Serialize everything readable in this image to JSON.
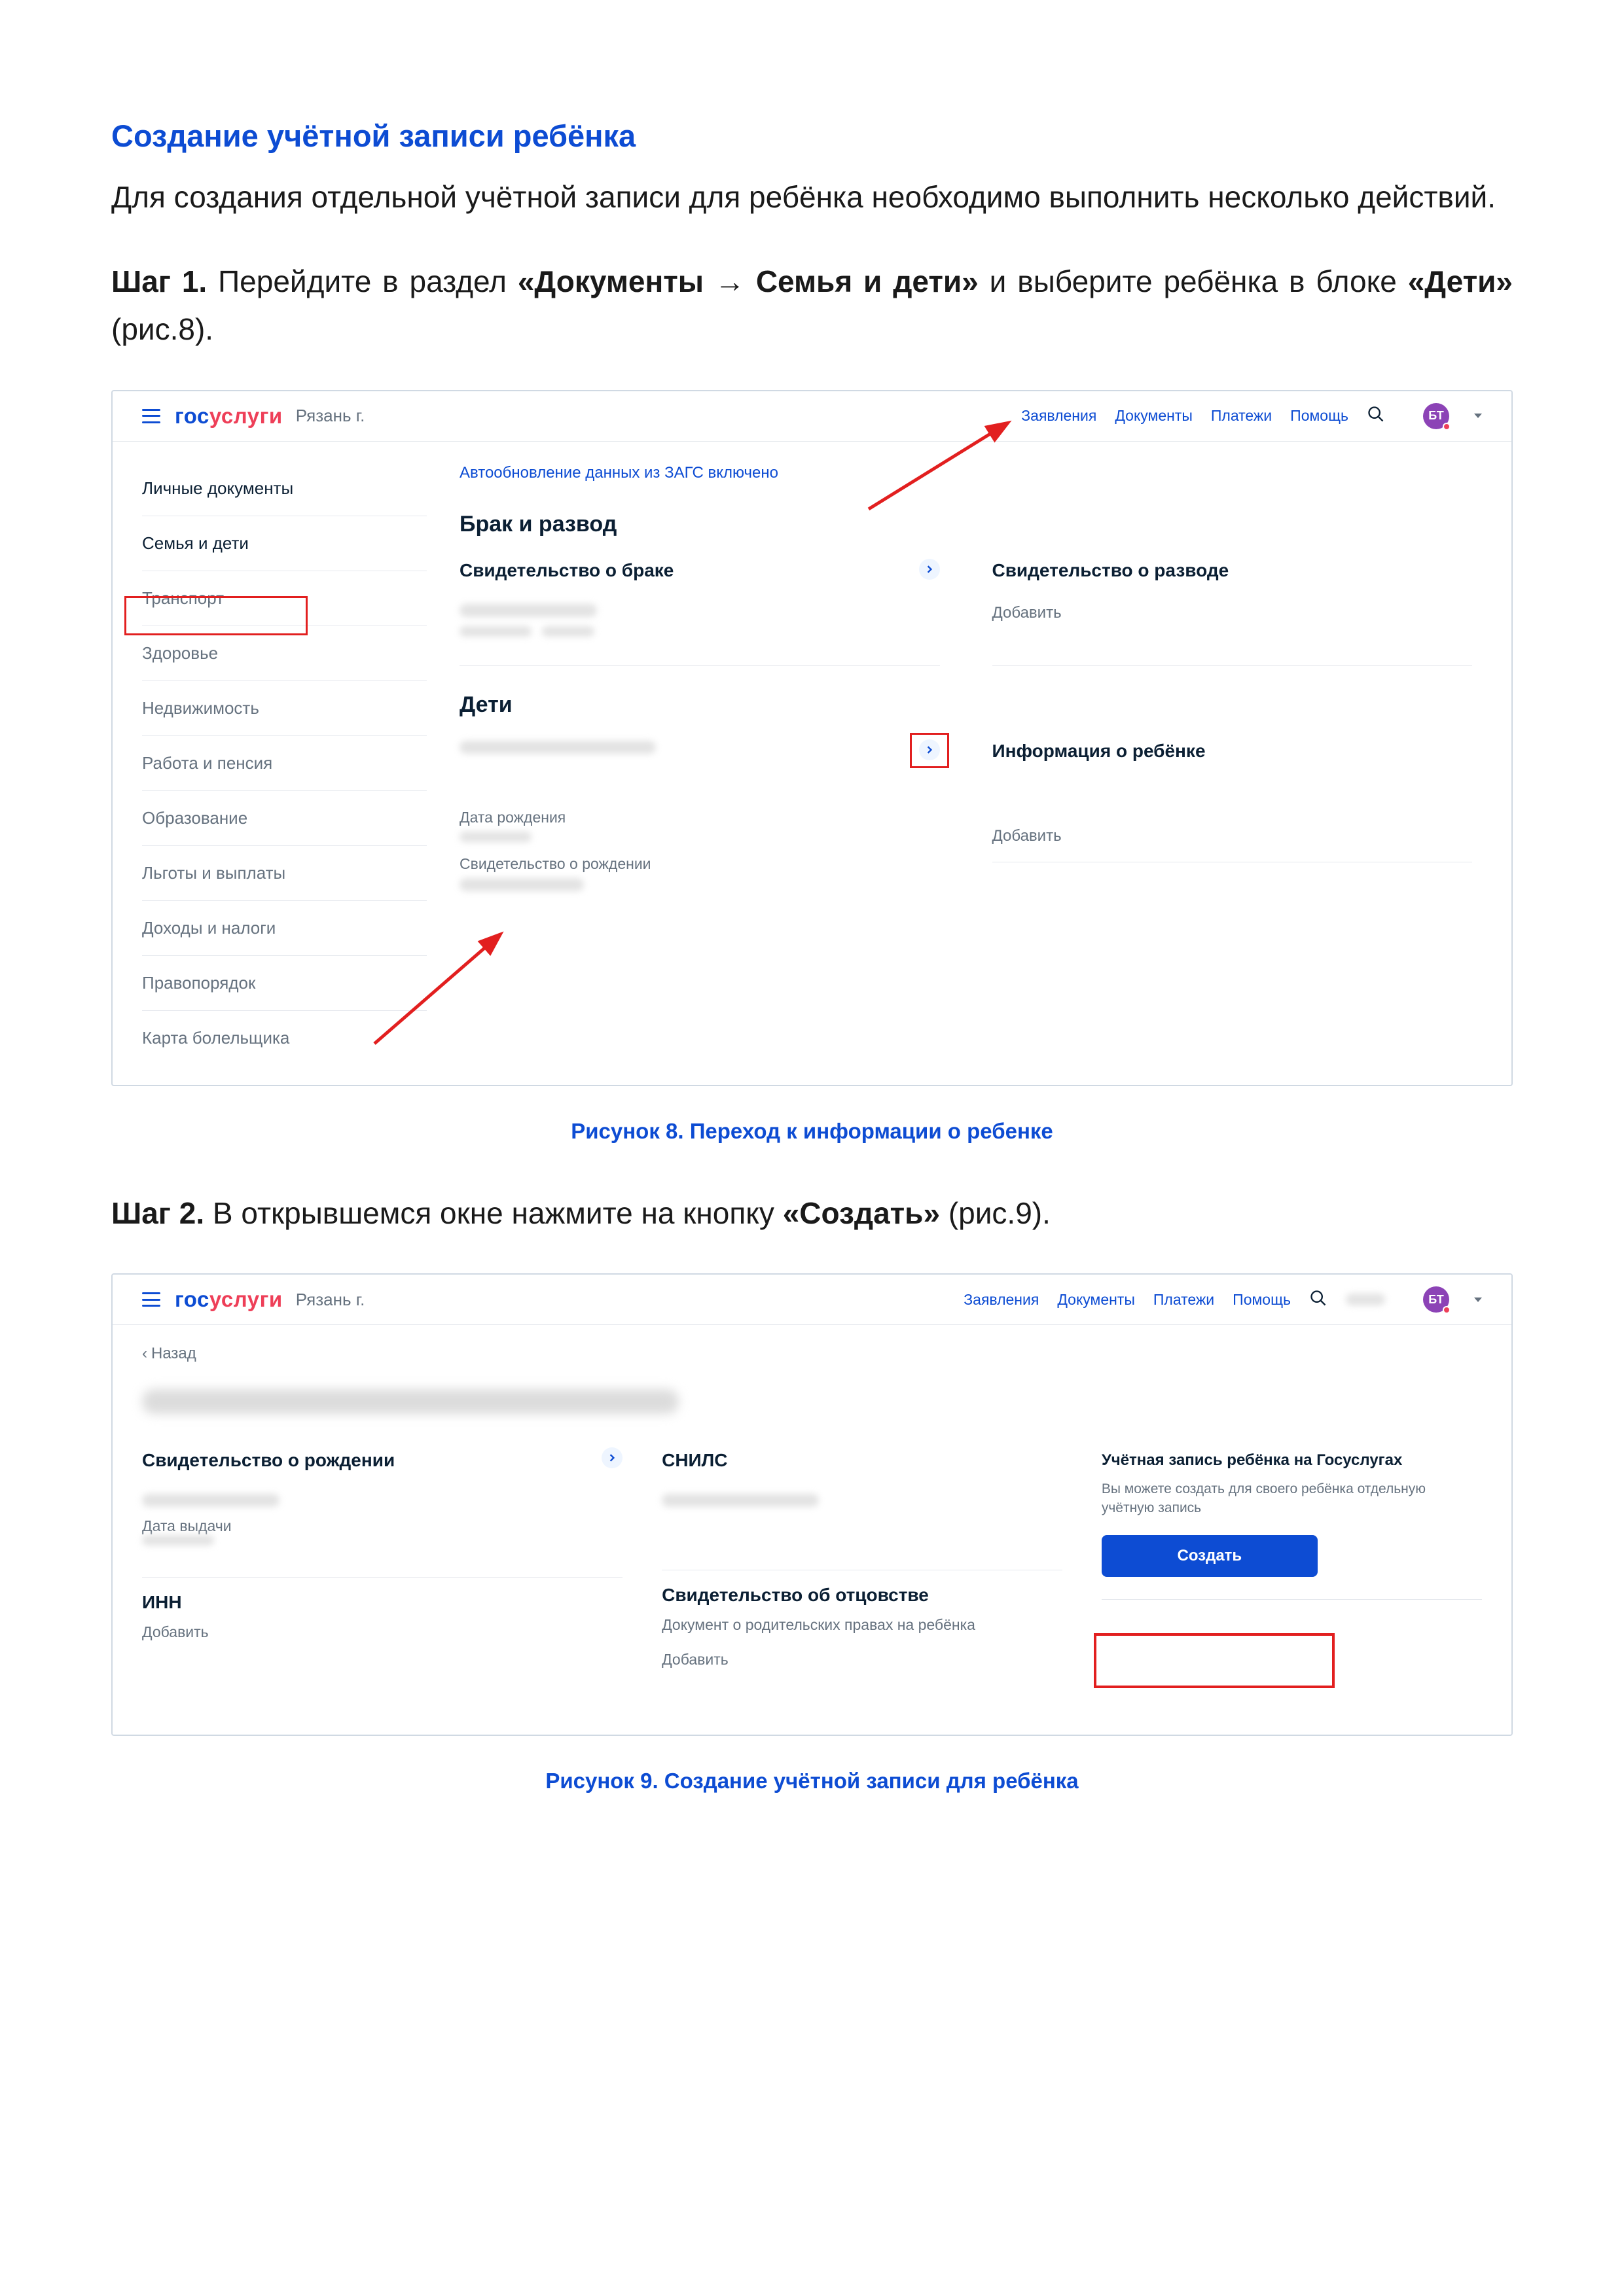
{
  "heading": "Создание учётной записи ребёнка",
  "intro": "Для создания отдельной учётной записи для ребёнка необходимо выполнить несколько действий.",
  "step1": {
    "label": "Шаг 1.",
    "before": " Перейдите в раздел ",
    "bold_nav": "«Документы → Семья и дети»",
    "middle": " и выберите ребёнка в блоке ",
    "bold_block": "«Дети»",
    "after": " (рис.8)."
  },
  "step2": {
    "label": "Шаг 2.",
    "before": " В открывшемся окне нажмите на кнопку ",
    "bold_btn": "«Создать»",
    "after": " (рис.9)."
  },
  "shared_header": {
    "logo_blue": "гос",
    "logo_red": "услуги",
    "city": "Рязань г.",
    "nav": [
      "Заявления",
      "Документы",
      "Платежи",
      "Помощь"
    ],
    "avatar": "БТ"
  },
  "fig8": {
    "side": [
      "Личные документы",
      "Семья и дети",
      "Транспорт",
      "Здоровье",
      "Недвижимость",
      "Работа и пенсия",
      "Образование",
      "Льготы и выплаты",
      "Доходы и налоги",
      "Правопорядок",
      "Карта болельщика"
    ],
    "auto": "Автообновление данных из ЗАГС включено",
    "block_marriage": "Брак и развод",
    "marriage_cert": "Свидетельство о браке",
    "divorce_cert": "Свидетельство о разводе",
    "add": "Добавить",
    "block_children": "Дети",
    "child_info": "Информация о ребёнке",
    "dob_label": "Дата рождения",
    "birth_cert": "Свидетельство о рождении",
    "caption": "Рисунок 8. Переход к информации о ребенке"
  },
  "fig9": {
    "back": "Назад",
    "birth_cert": "Свидетельство о рождении",
    "issue_date": "Дата выдачи",
    "inn": "ИНН",
    "add": "Добавить",
    "snils": "СНИЛС",
    "paternity": "Свидетельство об отцовстве",
    "paternity_sub": "Документ о родительских правах на ребёнка",
    "create_title": "Учётная запись ребёнка на Госуслугах",
    "create_desc": "Вы можете создать для своего ребёнка отдельную учётную запись",
    "create_btn": "Создать",
    "caption": "Рисунок 9. Создание учётной записи для ребёнка"
  }
}
